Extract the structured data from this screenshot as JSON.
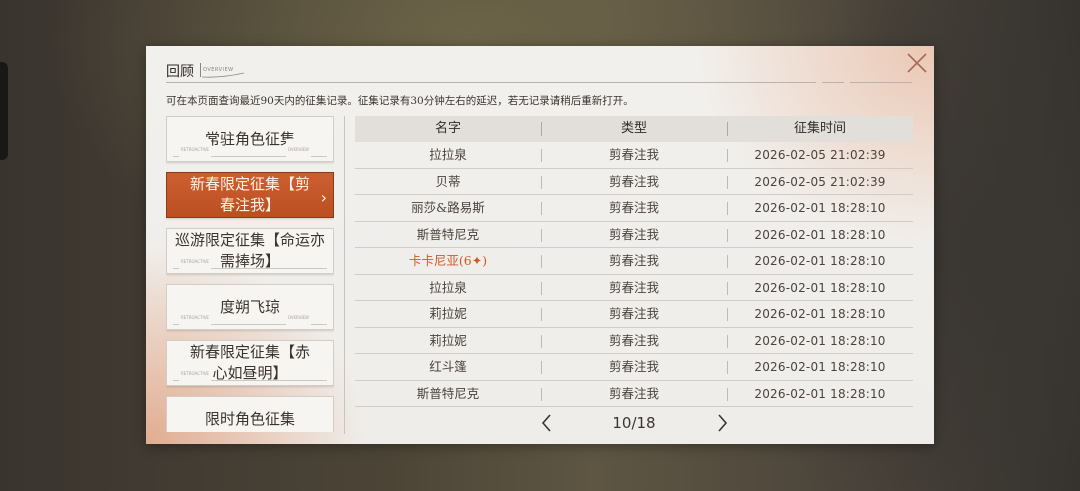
{
  "dialog": {
    "title": "回顾",
    "title_sub": "OVERVIEW",
    "notice": "可在本页面查询最近90天内的征集记录。征集记录有30分钟左右的延迟，若无记录请稍后重新打开。"
  },
  "sidebar": {
    "items": [
      {
        "label": "常驻角色征集",
        "active": false
      },
      {
        "label": "新春限定征集【剪春注我】",
        "active": true
      },
      {
        "label": "巡游限定征集【命运亦需捧场】",
        "active": false
      },
      {
        "label": "度朔飞琼",
        "active": false
      },
      {
        "label": "新春限定征集【赤心如昼明】",
        "active": false
      },
      {
        "label": "限时角色征集",
        "active": false
      }
    ],
    "deco_left": "RETROACTIVE",
    "deco_right": "OVERVIEW"
  },
  "table": {
    "headers": [
      "名字",
      "类型",
      "征集时间"
    ],
    "rows": [
      {
        "name": "拉拉泉",
        "type": "剪春注我",
        "time": "2026-02-05 21:02:39"
      },
      {
        "name": "贝蒂",
        "type": "剪春注我",
        "time": "2026-02-05 21:02:39"
      },
      {
        "name": "丽莎&路易斯",
        "type": "剪春注我",
        "time": "2026-02-01 18:28:10"
      },
      {
        "name": "斯普特尼克",
        "type": "剪春注我",
        "time": "2026-02-01 18:28:10"
      },
      {
        "name": "卡卡尼亚(6✦)",
        "type": "剪春注我",
        "time": "2026-02-01 18:28:10",
        "rare": true
      },
      {
        "name": "拉拉泉",
        "type": "剪春注我",
        "time": "2026-02-01 18:28:10"
      },
      {
        "name": "莉拉妮",
        "type": "剪春注我",
        "time": "2026-02-01 18:28:10"
      },
      {
        "name": "莉拉妮",
        "type": "剪春注我",
        "time": "2026-02-01 18:28:10"
      },
      {
        "name": "红斗篷",
        "type": "剪春注我",
        "time": "2026-02-01 18:28:10"
      },
      {
        "name": "斯普特尼克",
        "type": "剪春注我",
        "time": "2026-02-01 18:28:10"
      }
    ]
  },
  "pager": {
    "text": "10/18"
  },
  "colors": {
    "accent": "#c4552a",
    "rare_text": "#cf5a24",
    "panel_bg": "#f0eeeb"
  }
}
